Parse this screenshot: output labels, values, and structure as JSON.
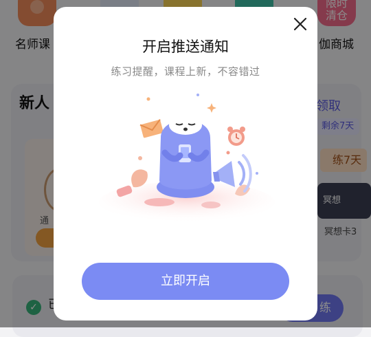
{
  "background": {
    "nav_labels": [
      "名师课",
      "伽商城"
    ],
    "promo_tile_text": "限时\n清仓",
    "new_user_heading": "新人",
    "claim_link": "领取",
    "remaining_badge": "剩余7天",
    "practice_7": "练7天",
    "sub_card_text": "通",
    "meditation_card": "冥想",
    "meditation_card_caption": "冥想卡3",
    "status_partial": "已",
    "practice_button": "练"
  },
  "dialog": {
    "title": "开启推送通知",
    "subtitle": "练习提醒，课程上新，不容错过",
    "cta_label": "立即开启",
    "accent_color": "#7b8bf3",
    "close_icon": "close-icon",
    "illustration": "sloth-holding-phone-notification"
  }
}
